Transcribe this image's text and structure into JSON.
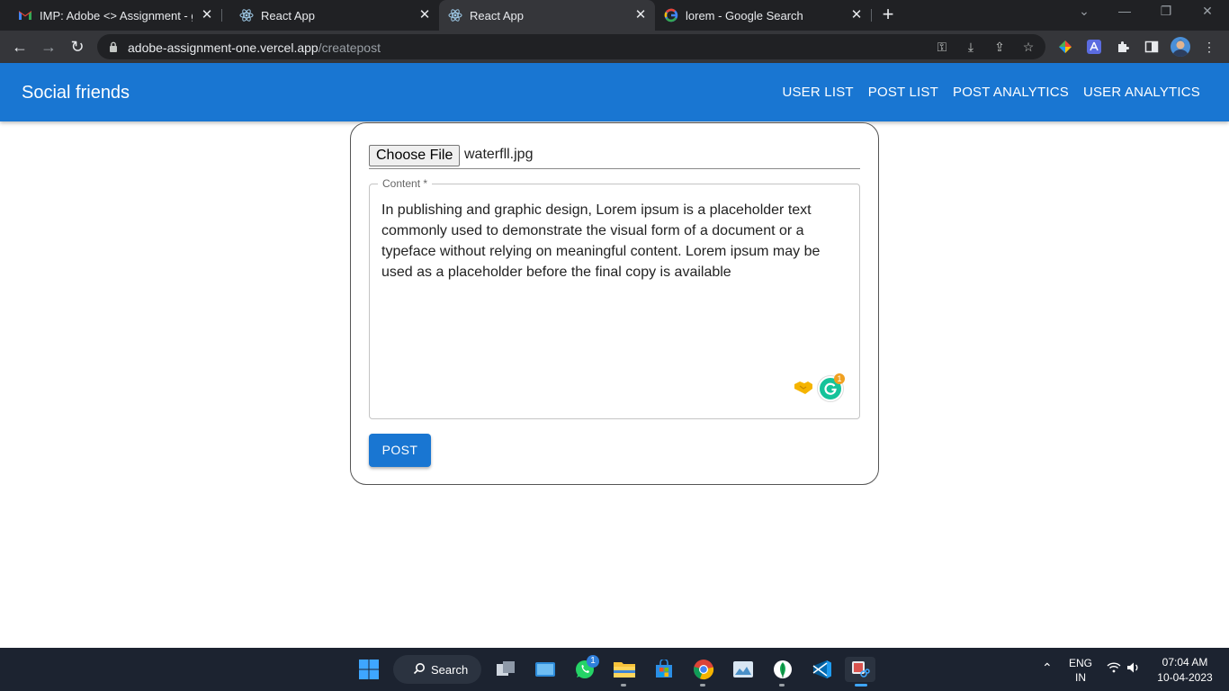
{
  "browser": {
    "tabs": [
      {
        "title": "IMP: Adobe <> Assignment - gh",
        "icon": "gmail-icon"
      },
      {
        "title": "React App",
        "icon": "react-icon"
      },
      {
        "title": "React App",
        "icon": "react-icon",
        "active": true
      },
      {
        "title": "lorem - Google Search",
        "icon": "google-icon"
      }
    ],
    "url_host": "adobe-assignment-one.vercel.app",
    "url_path": "/createpost"
  },
  "app": {
    "brand": "Social friends",
    "nav": [
      "USER LIST",
      "POST LIST",
      "POST ANALYTICS",
      "USER ANALYTICS"
    ],
    "accent_color": "#1976d2"
  },
  "form": {
    "choose_file_label": "Choose File",
    "file_name": "waterfll.jpg",
    "content_label": "Content *",
    "content_value": "In publishing and graphic design, Lorem ipsum is a placeholder text commonly used to demonstrate the visual form of a document or a typeface without relying on meaningful content. Lorem ipsum may be used as a placeholder before the final copy is available",
    "grammarly_count": "1",
    "post_label": "POST"
  },
  "taskbar": {
    "search_label": "Search",
    "whatsapp_badge": "1",
    "language": "ENG",
    "region": "IN",
    "time": "07:04 AM",
    "date": "10-04-2023"
  }
}
